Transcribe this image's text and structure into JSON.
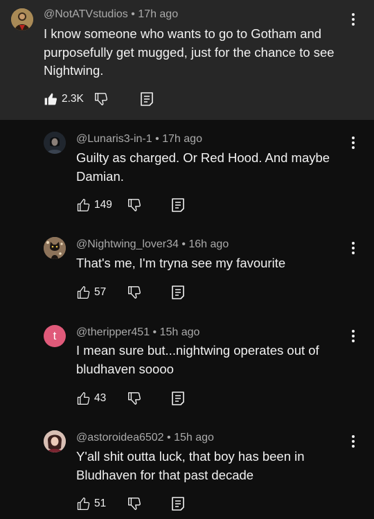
{
  "colors": {
    "background": "#0f0f0f",
    "thread_background": "#272727",
    "primary_text": "#f1f1f1",
    "secondary_text": "#aaaaaa",
    "letter_avatar": "#e05a7a"
  },
  "top_comment": {
    "author": "@NotATVstudios",
    "time": "17h ago",
    "text": "I know someone who wants to go to Gotham and purposefully get mugged, just for the chance to see Nightwing.",
    "likes": "2.3K",
    "liked": true,
    "avatar_icon": "photo-avatar",
    "icons": [
      "like-icon",
      "dislike-icon",
      "reply-icon",
      "more-icon"
    ]
  },
  "replies": [
    {
      "author": "@Lunaris3-in-1",
      "time": "17h ago",
      "text": "Guilty as charged. Or Red Hood. And maybe Damian.",
      "likes": "149",
      "avatar_icon": "photo-avatar"
    },
    {
      "author": "@Nightwing_lover34",
      "time": "16h ago",
      "text": "That's me, I'm tryna see my favourite",
      "likes": "57",
      "avatar_icon": "cat-avatar"
    },
    {
      "author": "@theripper451",
      "time": "15h ago",
      "text": "I mean sure but...nightwing operates out of bludhaven soooo",
      "likes": "43",
      "avatar_letter": "t"
    },
    {
      "author": "@astoroidea6502",
      "time": "15h ago",
      "text": "Y'all shit outta luck, that boy has been in Bludhaven for that past decade",
      "likes": "51",
      "avatar_icon": "photo-avatar"
    }
  ]
}
